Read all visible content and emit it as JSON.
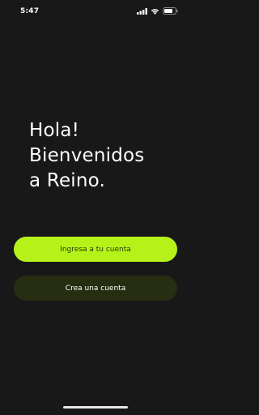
{
  "status_bar": {
    "time": "5:47",
    "icons": [
      "signal-icon",
      "wifi-icon",
      "battery-icon"
    ]
  },
  "greeting": {
    "line1": "Hola!",
    "line2": "Bienvenidos",
    "line3": "a Reino."
  },
  "buttons": {
    "login_label": "Ingresa a tu cuenta",
    "signup_label": "Crea una cuenta"
  },
  "colors": {
    "background": "#181818",
    "accent": "#b5f21a",
    "secondary_button": "#262d10"
  }
}
